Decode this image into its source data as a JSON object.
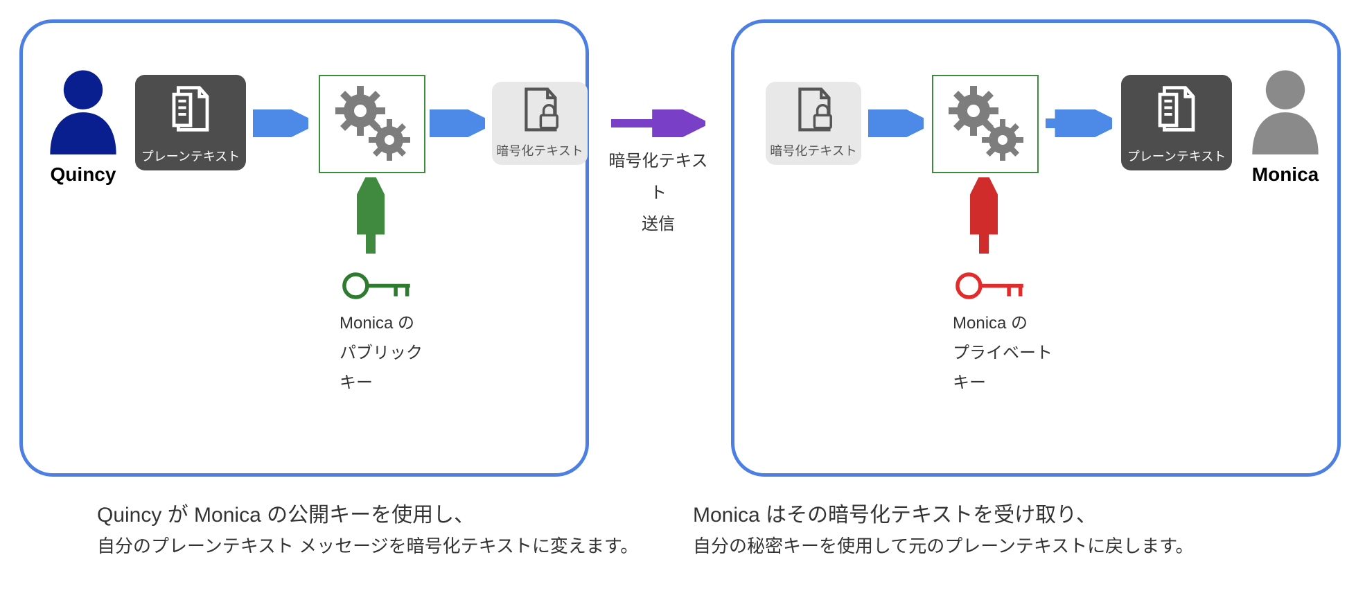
{
  "left": {
    "sender_name": "Quincy",
    "plaintext_label": "プレーンテキスト",
    "ciphertext_label": "暗号化テキスト",
    "key_owner": "Monica の",
    "key_type": "パブリック",
    "key_word": "キー",
    "caption_top": "Quincy が Monica の公開キーを使用し、",
    "caption_bottom": "自分のプレーンテキスト メッセージを暗号化テキストに変えます。"
  },
  "middle": {
    "send_line1": "暗号化テキスト",
    "send_line2": "送信"
  },
  "right": {
    "receiver_name": "Monica",
    "plaintext_label": "プレーンテキスト",
    "ciphertext_label": "暗号化テキスト",
    "key_owner": "Monica の",
    "key_type": "プライベート",
    "key_word": "キー",
    "caption_top": "Monica はその暗号化テキストを受け取り、",
    "caption_bottom": "自分の秘密キーを使用して元のプレーンテキストに戻します。"
  },
  "colors": {
    "frame": "#4d7fe2",
    "arrow_blue": "#4d8ae8",
    "arrow_green": "#3f8a3f",
    "arrow_red": "#d12c2c",
    "arrow_purple": "#7a3fc7",
    "person_sender": "#0a1f8f",
    "person_receiver": "#8a8a8a",
    "gear_green_border": "#3f8a3f",
    "gear_fill": "#7d7d7d",
    "key_green": "#2e7a2e",
    "key_red": "#e02c2c"
  }
}
